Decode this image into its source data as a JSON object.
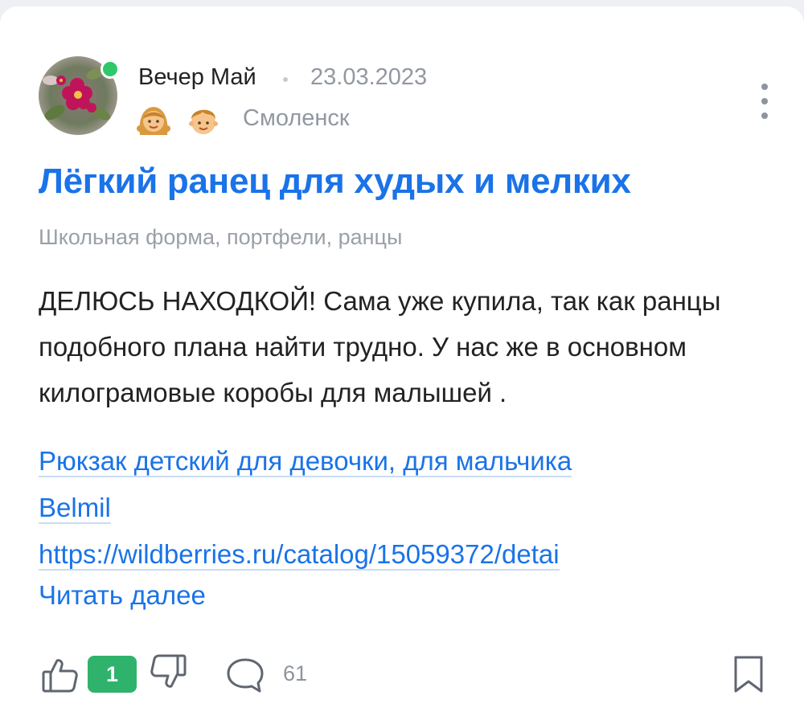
{
  "post": {
    "author": "Вечер Май",
    "date": "23.03.2023",
    "city": "Смоленск",
    "title": "Лёгкий ранец для худых и мелких",
    "category": "Школьная форма, портфели, ранцы",
    "body": "ДЕЛЮСЬ НАХОДКОЙ! Сама уже купила, так как ранцы подобного плана найти трудно. У нас же в основном килограмовые коробы для малышей .",
    "link_line1": "Рюкзак детский для девочки, для мальчика",
    "link_line2": "Belmil",
    "link_line3": "https://wildberries.ru/catalog/15059372/detai",
    "read_more": "Читать далее"
  },
  "footer": {
    "score": "1",
    "comment_count": "61"
  },
  "icons": {
    "avatar": "flower-avatar",
    "online": "online-indicator",
    "kids": [
      "girl-icon",
      "boy-icon"
    ],
    "menu": "more-vertical-icon",
    "like": "thumbs-up-icon",
    "dislike": "thumbs-down-icon",
    "comment": "comment-bubble-icon",
    "bookmark": "bookmark-icon"
  },
  "colors": {
    "accent": "#1a73e8",
    "online": "#2fc869",
    "score_bg": "#2fb36c",
    "muted": "#9298a1"
  }
}
